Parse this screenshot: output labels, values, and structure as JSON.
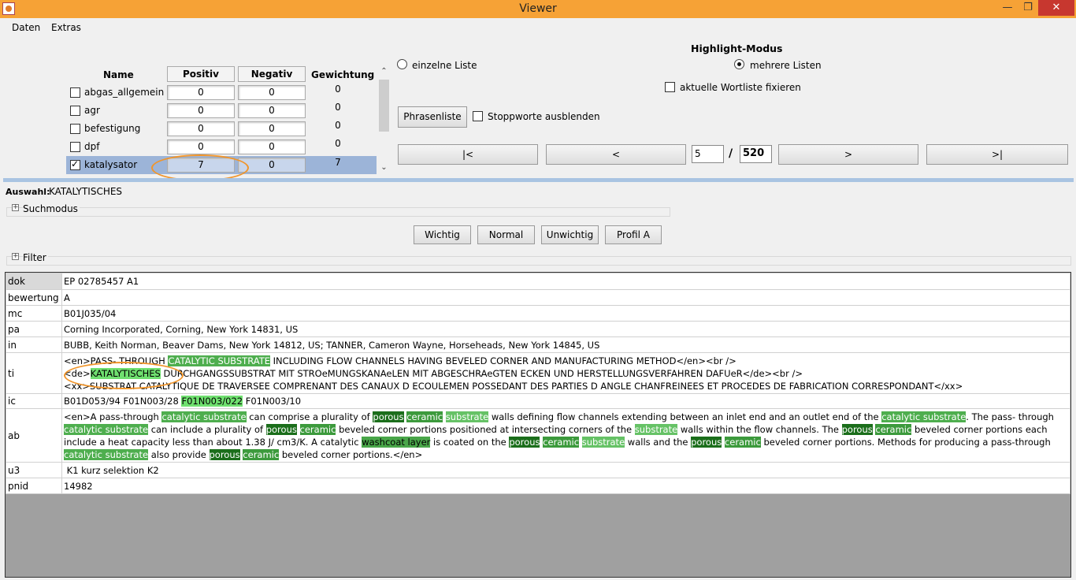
{
  "window": {
    "title": "Viewer"
  },
  "menu": [
    "Daten",
    "Extras"
  ],
  "list": {
    "headers": {
      "name": "Name",
      "positiv": "Positiv",
      "negativ": "Negativ",
      "gewichtung": "Gewichtung"
    },
    "rows": [
      {
        "name": "abgas_allgemein",
        "checked": false,
        "positiv": "0",
        "negativ": "0",
        "gewichtung": "0"
      },
      {
        "name": "agr",
        "checked": false,
        "positiv": "0",
        "negativ": "0",
        "gewichtung": "0"
      },
      {
        "name": "befestigung",
        "checked": false,
        "positiv": "0",
        "negativ": "0",
        "gewichtung": "0"
      },
      {
        "name": "dpf",
        "checked": false,
        "positiv": "0",
        "negativ": "0",
        "gewichtung": "0"
      },
      {
        "name": "katalysator",
        "checked": true,
        "positiv": "7",
        "negativ": "0",
        "gewichtung": "7",
        "selected": true
      }
    ]
  },
  "highlight": {
    "title": "Highlight-Modus",
    "single": "einzelne Liste",
    "multi": "mehrere Listen",
    "fix": "aktuelle Wortliste fixieren"
  },
  "phrase_button": "Phrasenliste",
  "stopwords": "Stoppworte ausblenden",
  "nav": {
    "first": "|<",
    "prev": "<",
    "next": ">",
    "last": ">|",
    "current": "5",
    "sep": "/",
    "total": "520"
  },
  "auswahl": {
    "label": "Auswahl:",
    "value": "KATALYTISCHES"
  },
  "suchmodus": "Suchmodus",
  "filter": "Filter",
  "priority_buttons": [
    "Wichtig",
    "Normal",
    "Unwichtig",
    "Profil A"
  ],
  "record": {
    "dok": {
      "key": "dok",
      "value": "EP 02785457 A1"
    },
    "bewertung": {
      "key": "bewertung",
      "value": "A"
    },
    "mc": {
      "key": "mc",
      "value": "B01J035/04"
    },
    "pa": {
      "key": "pa",
      "value": "Corning Incorporated, Corning, New York 14831, US"
    },
    "in": {
      "key": "in",
      "value": "BUBB, Keith Norman, Beaver Dams, New York 14812, US; TANNER, Cameron Wayne, Horseheads, New York 14845, US"
    },
    "ti": {
      "key": "ti",
      "en_a": "<en>PASS- THROUGH ",
      "en_hl": "CATALYTIC SUBSTRATE",
      "en_b": " INCLUDING FLOW CHANNELS HAVING BEVELED CORNER AND MANUFACTURING METHOD</en><br />",
      "de_a": "<de>",
      "de_hl": "KATALYTISCHES",
      "de_b": " DURCHGANGSSUBSTRAT MIT STROeMUNGSKANAeLEN MIT ABGESCHRAeGTEN ECKEN UND HERSTELLUNGSVERFAHREN DAFUeR</de><br />",
      "xx": "<xx>SUBSTRAT CATALYTIQUE DE TRAVERSEE COMPRENANT DES CANAUX D ECOULEMEN POSSEDANT DES PARTIES D ANGLE CHANFREINEES ET PROCEDES DE FABRICATION CORRESPONDANT</xx>"
    },
    "ic": {
      "key": "ic",
      "a": "B01D053/94 F01N003/28 ",
      "hl": "F01N003/022",
      "b": " F01N003/10"
    },
    "ab": {
      "key": "ab",
      "parts": [
        {
          "t": "<en>A pass-through ",
          "c": ""
        },
        {
          "t": "catalytic substrate",
          "c": "hl-l"
        },
        {
          "t": " can comprise a plurality of ",
          "c": ""
        },
        {
          "t": "porous",
          "c": "hl-d"
        },
        {
          "t": " ",
          "c": ""
        },
        {
          "t": "ceramic",
          "c": "hl-m"
        },
        {
          "t": " ",
          "c": ""
        },
        {
          "t": "substrate",
          "c": "hl-s"
        },
        {
          "t": " walls defining flow channels extending between an inlet end and an outlet end of the ",
          "c": ""
        },
        {
          "t": "catalytic substrate",
          "c": "hl-l"
        },
        {
          "t": ". The pass- through ",
          "c": ""
        },
        {
          "t": "catalytic substrate",
          "c": "hl-l"
        },
        {
          "t": " can include a plurality of ",
          "c": ""
        },
        {
          "t": "porous",
          "c": "hl-d"
        },
        {
          "t": " ",
          "c": ""
        },
        {
          "t": "ceramic",
          "c": "hl-m"
        },
        {
          "t": " beveled corner portions positioned at intersecting corners of the ",
          "c": ""
        },
        {
          "t": "substrate",
          "c": "hl-s"
        },
        {
          "t": " walls within the flow channels. The ",
          "c": ""
        },
        {
          "t": "porous",
          "c": "hl-d"
        },
        {
          "t": " ",
          "c": ""
        },
        {
          "t": "ceramic",
          "c": "hl-m"
        },
        {
          "t": " beveled corner portions each include a heat capacity less than about 1.38 J/ cm3/K. A catalytic ",
          "c": ""
        },
        {
          "t": "washcoat layer",
          "c": "hl-w"
        },
        {
          "t": " is coated on the ",
          "c": ""
        },
        {
          "t": "porous",
          "c": "hl-d"
        },
        {
          "t": " ",
          "c": ""
        },
        {
          "t": "ceramic",
          "c": "hl-m"
        },
        {
          "t": " ",
          "c": ""
        },
        {
          "t": "substrate",
          "c": "hl-s"
        },
        {
          "t": " walls and the ",
          "c": ""
        },
        {
          "t": "porous",
          "c": "hl-d"
        },
        {
          "t": " ",
          "c": ""
        },
        {
          "t": "ceramic",
          "c": "hl-m"
        },
        {
          "t": " beveled corner portions. Methods for producing a pass-through ",
          "c": ""
        },
        {
          "t": "catalytic substrate",
          "c": "hl-l"
        },
        {
          "t": " also provide ",
          "c": ""
        },
        {
          "t": "porous",
          "c": "hl-d"
        },
        {
          "t": " ",
          "c": ""
        },
        {
          "t": "ceramic",
          "c": "hl-m"
        },
        {
          "t": " beveled corner portions.</en>",
          "c": ""
        }
      ]
    },
    "u3": {
      "key": "u3",
      "value": " K1 kurz selektion K2"
    },
    "pnid": {
      "key": "pnid",
      "value": "14982"
    }
  },
  "colors": {
    "titlebar": "#f6a236",
    "selection": "#9cb4d8",
    "highlight_green": "#4eae4e",
    "annotation": "#f1952a"
  }
}
